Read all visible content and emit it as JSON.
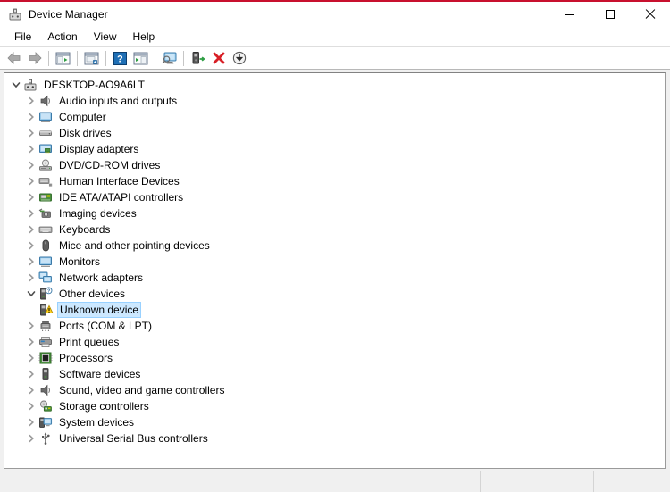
{
  "window": {
    "title": "Device Manager",
    "title_icon": "device-manager-icon",
    "accent_color": "#c8102e",
    "controls": {
      "minimize": "minimize-icon",
      "maximize": "maximize-icon",
      "close": "close-icon"
    }
  },
  "menubar": {
    "items": [
      {
        "label": "File"
      },
      {
        "label": "Action"
      },
      {
        "label": "View"
      },
      {
        "label": "Help"
      }
    ]
  },
  "toolbar": {
    "buttons": [
      {
        "name": "back-button",
        "icon": "arrow-left-icon",
        "tooltip": "Back"
      },
      {
        "name": "forward-button",
        "icon": "arrow-right-icon",
        "tooltip": "Forward"
      },
      {
        "name": "separator-1",
        "icon": "separator"
      },
      {
        "name": "show-hide-console-tree-button",
        "icon": "console-tree-icon",
        "tooltip": "Show/Hide Console Tree"
      },
      {
        "name": "separator-2",
        "icon": "separator"
      },
      {
        "name": "properties-button",
        "icon": "properties-window-icon",
        "tooltip": "Properties"
      },
      {
        "name": "separator-3",
        "icon": "separator"
      },
      {
        "name": "help-button",
        "icon": "help-question-icon",
        "tooltip": "Help"
      },
      {
        "name": "show-hide-action-pane-button",
        "icon": "action-pane-icon",
        "tooltip": "Show/Hide Action Pane"
      },
      {
        "name": "separator-4",
        "icon": "separator"
      },
      {
        "name": "scan-for-hardware-changes-button",
        "icon": "scan-monitor-icon",
        "tooltip": "Scan for hardware changes"
      },
      {
        "name": "separator-5",
        "icon": "separator"
      },
      {
        "name": "update-driver-button",
        "icon": "update-driver-icon",
        "tooltip": "Update driver"
      },
      {
        "name": "uninstall-device-button",
        "icon": "red-x-icon",
        "tooltip": "Uninstall device"
      },
      {
        "name": "disable-device-button",
        "icon": "disable-down-arrow-icon",
        "tooltip": "Disable device"
      }
    ]
  },
  "tree": {
    "selected_index": 13,
    "selection_color": "#cce8ff",
    "nodes": [
      {
        "label": "DESKTOP-AO9A6LT",
        "level": 0,
        "state": "expanded",
        "icon": "computer-node-icon",
        "selected": false
      },
      {
        "label": "Audio inputs and outputs",
        "level": 1,
        "state": "collapsed",
        "icon": "speaker-icon",
        "selected": false
      },
      {
        "label": "Computer",
        "level": 1,
        "state": "collapsed",
        "icon": "monitor-icon",
        "selected": false
      },
      {
        "label": "Disk drives",
        "level": 1,
        "state": "collapsed",
        "icon": "disk-drive-icon",
        "selected": false
      },
      {
        "label": "Display adapters",
        "level": 1,
        "state": "collapsed",
        "icon": "display-adapter-icon",
        "selected": false
      },
      {
        "label": "DVD/CD-ROM drives",
        "level": 1,
        "state": "collapsed",
        "icon": "dvd-drive-icon",
        "selected": false
      },
      {
        "label": "Human Interface Devices",
        "level": 1,
        "state": "collapsed",
        "icon": "hid-icon",
        "selected": false
      },
      {
        "label": "IDE ATA/ATAPI controllers",
        "level": 1,
        "state": "collapsed",
        "icon": "ide-controller-icon",
        "selected": false
      },
      {
        "label": "Imaging devices",
        "level": 1,
        "state": "collapsed",
        "icon": "camera-icon",
        "selected": false
      },
      {
        "label": "Keyboards",
        "level": 1,
        "state": "collapsed",
        "icon": "keyboard-icon",
        "selected": false
      },
      {
        "label": "Mice and other pointing devices",
        "level": 1,
        "state": "collapsed",
        "icon": "mouse-icon",
        "selected": false
      },
      {
        "label": "Monitors",
        "level": 1,
        "state": "collapsed",
        "icon": "monitor-icon",
        "selected": false
      },
      {
        "label": "Network adapters",
        "level": 1,
        "state": "collapsed",
        "icon": "network-adapter-icon",
        "selected": false
      },
      {
        "label": "Other devices",
        "level": 1,
        "state": "expanded",
        "icon": "unknown-device-icon",
        "selected": false
      },
      {
        "label": "Unknown device",
        "level": 2,
        "state": "leaf",
        "icon": "unknown-device-warning-icon",
        "selected": true
      },
      {
        "label": "Ports (COM & LPT)",
        "level": 1,
        "state": "collapsed",
        "icon": "port-icon",
        "selected": false
      },
      {
        "label": "Print queues",
        "level": 1,
        "state": "collapsed",
        "icon": "printer-icon",
        "selected": false
      },
      {
        "label": "Processors",
        "level": 1,
        "state": "collapsed",
        "icon": "processor-icon",
        "selected": false
      },
      {
        "label": "Software devices",
        "level": 1,
        "state": "collapsed",
        "icon": "software-device-icon",
        "selected": false
      },
      {
        "label": "Sound, video and game controllers",
        "level": 1,
        "state": "collapsed",
        "icon": "speaker-icon",
        "selected": false
      },
      {
        "label": "Storage controllers",
        "level": 1,
        "state": "collapsed",
        "icon": "storage-controller-icon",
        "selected": false
      },
      {
        "label": "System devices",
        "level": 1,
        "state": "collapsed",
        "icon": "system-device-icon",
        "selected": false
      },
      {
        "label": "Universal Serial Bus controllers",
        "level": 1,
        "state": "collapsed",
        "icon": "usb-icon",
        "selected": false
      }
    ]
  },
  "statusbar": {
    "panes": [
      {
        "text": ""
      },
      {
        "text": ""
      },
      {
        "text": ""
      }
    ]
  }
}
